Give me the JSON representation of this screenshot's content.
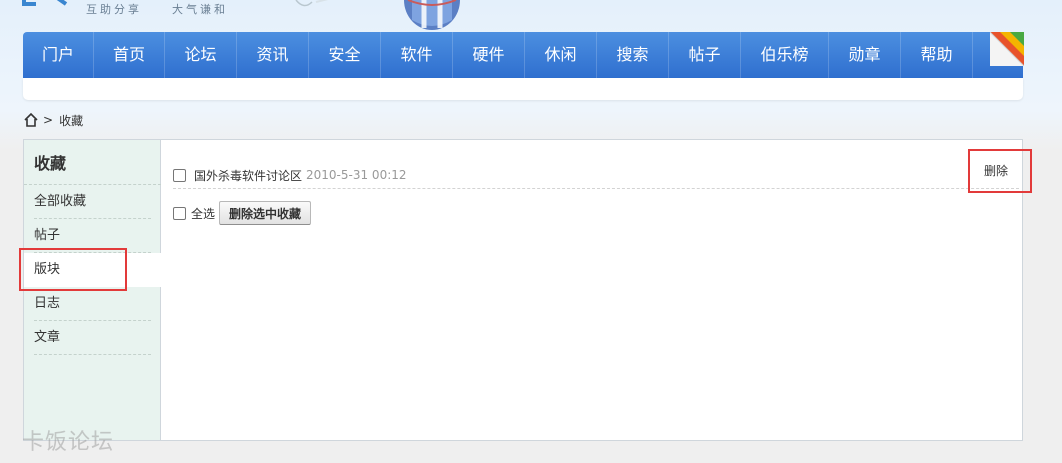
{
  "header": {
    "tagline_1": "互助分享",
    "tagline_2": "大气谦和"
  },
  "nav": {
    "items": [
      "门户",
      "首页",
      "论坛",
      "资讯",
      "安全",
      "软件",
      "硬件",
      "休闲",
      "搜索",
      "帖子",
      "伯乐榜",
      "勋章",
      "帮助"
    ]
  },
  "breadcrumb": {
    "separator": ">",
    "current": "收藏"
  },
  "sidebar": {
    "title": "收藏",
    "items": [
      {
        "label": "全部收藏"
      },
      {
        "label": "帖子"
      },
      {
        "label": "版块"
      },
      {
        "label": "日志"
      },
      {
        "label": "文章"
      }
    ],
    "active_index": 2
  },
  "favorites": [
    {
      "title": "国外杀毒软件讨论区",
      "date": "2010-5-31 00:12",
      "action": "删除"
    }
  ],
  "bulk": {
    "select_all_label": "全选",
    "delete_selected_label": "删除选中收藏"
  },
  "watermark": "卡饭论坛",
  "colors": {
    "nav_top": "#4c8fe0",
    "nav_bottom": "#2f6fcf",
    "sidebar_bg": "#e8f3ef",
    "highlight": "#e23a3a"
  }
}
